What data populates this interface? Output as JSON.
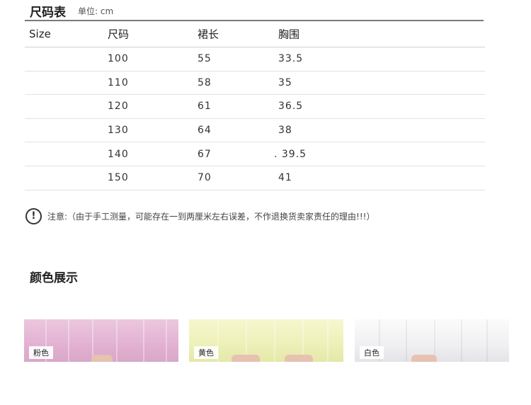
{
  "size_chart": {
    "title": "尺码表",
    "unit": "单位: cm",
    "headers": [
      "Size",
      "尺码",
      "裙长",
      "胸围"
    ],
    "rows": [
      [
        "",
        "100",
        "55",
        "33.5"
      ],
      [
        "",
        "110",
        "58",
        "35"
      ],
      [
        "",
        "120",
        "61",
        "36.5"
      ],
      [
        "",
        "130",
        "64",
        "38"
      ],
      [
        "",
        "140",
        "67",
        ". 39.5"
      ],
      [
        "",
        "150",
        "70",
        "41"
      ]
    ]
  },
  "note": {
    "icon": "exclamation-circle-icon",
    "icon_glyph": "!",
    "text": "注意:（由于手工测量，可能存在一到两厘米左右误差，不作退换货卖家责任的理由!!!）"
  },
  "colors": {
    "title": "颜色展示",
    "swatches": [
      {
        "label": "粉色",
        "hex": "#e3b3d3"
      },
      {
        "label": "黄色",
        "hex": "#eef1b9"
      },
      {
        "label": "白色",
        "hex": "#f2f2f4"
      }
    ]
  }
}
